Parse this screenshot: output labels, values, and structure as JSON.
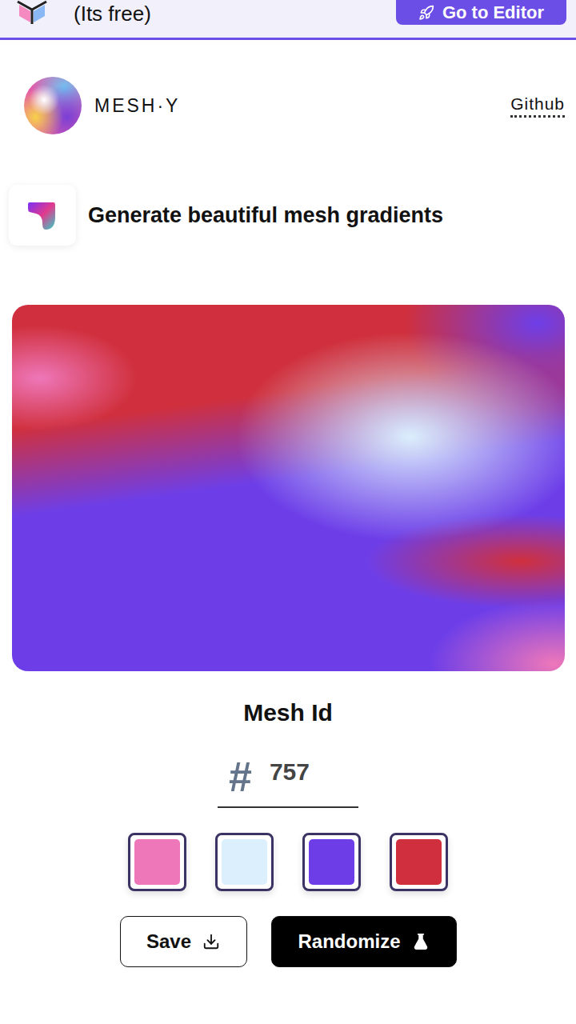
{
  "banner": {
    "note": "(Its free)",
    "button": "Go to Editor"
  },
  "header": {
    "brand": "MESH·Y",
    "link": "Github"
  },
  "tagline": "Generate beautiful mesh gradients",
  "mesh": {
    "label": "Mesh Id",
    "hash": "#",
    "id": "757"
  },
  "palette": [
    {
      "color": "#ee77b9"
    },
    {
      "color": "#dbeffd"
    },
    {
      "color": "#6d3ee8"
    },
    {
      "color": "#d0303d"
    }
  ],
  "buttons": [
    {
      "label": "Save",
      "kind": "outline"
    },
    {
      "label": "Randomize",
      "kind": "solid"
    }
  ]
}
